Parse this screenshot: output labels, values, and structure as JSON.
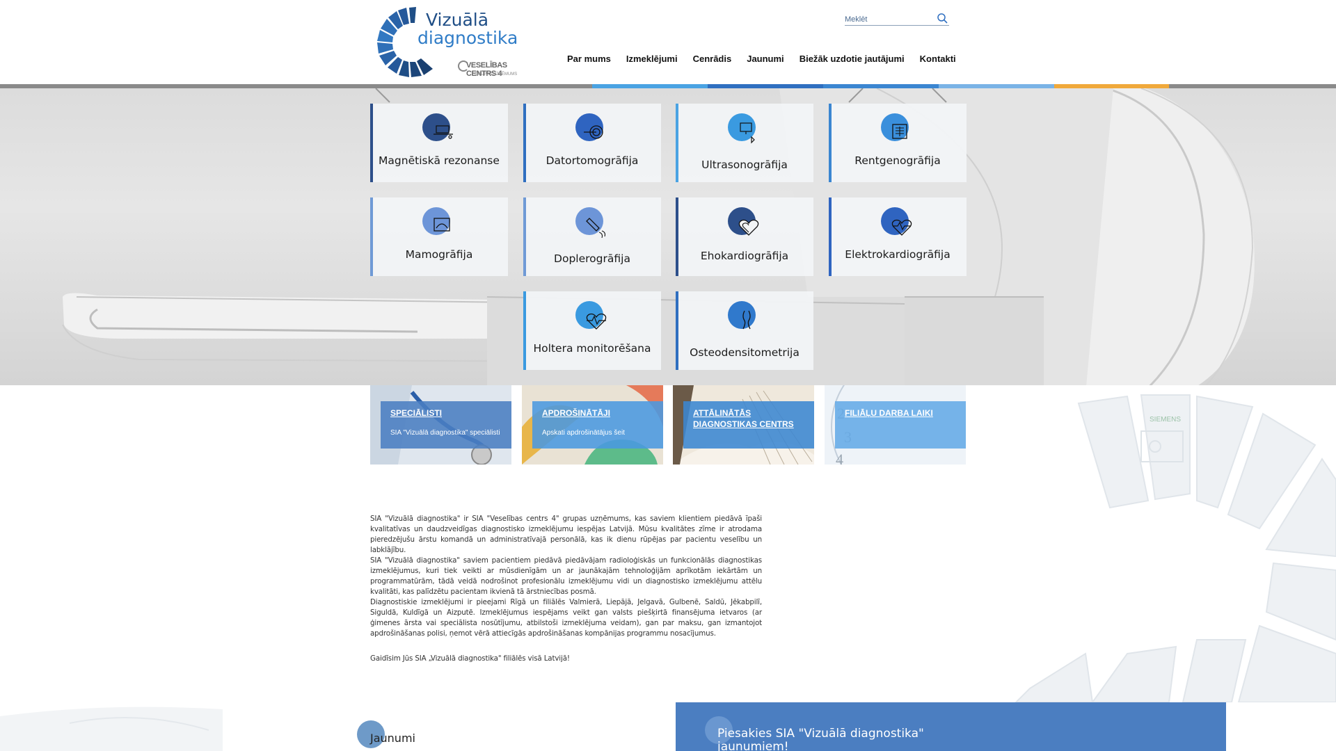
{
  "brand": {
    "name_line1": "Vizuālā",
    "name_line2": "diagnostika",
    "group_name": "VESELĪBAS CENTRS 4",
    "group_sub": "GRUPAS UZŅĒMUMS"
  },
  "search": {
    "placeholder": "Meklēt",
    "icon": "search-icon"
  },
  "nav": {
    "items": [
      "Par mums",
      "Izmeklējumi",
      "Cenrādis",
      "Jaunumi",
      "Biežāk uzdotie jautājumi",
      "Kontakti"
    ]
  },
  "colors": {
    "primary": "#2f6fc0",
    "dark_blue": "#2d4f8a",
    "light_blue": "#4aa3e3",
    "accent_orange": "#f0a93b",
    "stripe_grey": "#8a8a8a"
  },
  "services": [
    {
      "label": "Magnētiskā rezonanse",
      "icon": "mri-icon"
    },
    {
      "label": "Datortomogrāfija",
      "icon": "ct-scanner-icon"
    },
    {
      "label": "Ultrasonogrāfija",
      "icon": "ultrasound-monitor-icon"
    },
    {
      "label": "Rentgenogrāfija",
      "icon": "xray-chest-icon"
    },
    {
      "label": "Mamogrāfija",
      "icon": "mammography-icon"
    },
    {
      "label": "Doplerogrāfija",
      "icon": "doppler-probe-icon"
    },
    {
      "label": "Ehokardiogrāfija",
      "icon": "heart-icon"
    },
    {
      "label": "Elektrokardiogrāfija",
      "icon": "heart-ecg-icon"
    },
    {
      "label": "Holtera monitorēšana",
      "icon": "heart-monitor-icon"
    },
    {
      "label": "Osteodensitometrija",
      "icon": "bone-icon"
    }
  ],
  "info_boxes": [
    {
      "title": "SPECIĀLISTI",
      "subtitle": "SIA \"Vizuālā diagnostika\" speciālisti"
    },
    {
      "title": "APDROŠINĀTĀJI",
      "subtitle": "Apskati apdrošinātājus šeit"
    },
    {
      "title": "ATTĀLINĀTĀS DIAGNOSTIKAS CENTRS",
      "subtitle": ""
    },
    {
      "title": "FILIĀĻU DARBA LAIKI",
      "subtitle": ""
    }
  ],
  "about": {
    "p1": "SIA \"Vizuālā diagnostika\" ir SIA \"Veselības centrs 4\" grupas uzņēmums, kas saviem klientiem piedāvā īpaši kvalitatīvas un daudzveidīgas diagnostisko izmeklējumu iespējas Latvijā. Mūsu kvalitātes zīme ir atrodama pieredzējušu ārstu komandā un administratīvajā personālā, kas ik dienu rūpējas par pacientu veselību un labklājību.",
    "p2": "SIA \"Vizuālā diagnostika\" saviem pacientiem piedāvā piedāvājam radioloģiskās un funkcionālās diagnostikas izmeklējumus, kuri tiek veikti ar mūsdienīgām un ar jaunākajām tehnoloģijām aprīkotām iekārtām un programmatūrām, tādā veidā nodrošinot profesionālu izmeklējumu vidi un diagnostisko izmeklējumu attēlu kvalitāti, kas palīdzētu pacientam ikvienā tā ārstniecības posmā.",
    "p3": "Diagnostiskie izmeklējumi ir pieejami Rīgā un filiālēs Valmierā, Liepājā, Jelgavā, Gulbenē, Saldū, Jēkabpilī, Siguldā, Kuldīgā un Aizputē. Izmeklējumus iespējams veikt gan valsts piešķirtā finansējuma ietvaros (ar ģimenes ārsta vai speciālista nosūtījumu, atbilstoši izmeklējuma veidam), gan par maksu, gan izmantojot apdrošināšanas polisi, ņemot vērā attiecīgās apdrošināšanas kompānijas programmu nosacījumus.",
    "closing": "Gaidīsim Jūs SIA „Vizuālā diagnostika\" filiālēs visā Latvijā!"
  },
  "news": {
    "title": "Jaunumi"
  },
  "subscribe": {
    "text_line1": "Piesakies SIA \"Vizuālā diagnostika\"",
    "text_line2": "jaunumiem!"
  },
  "watermark": {
    "brand_text": "SIEMENS"
  }
}
